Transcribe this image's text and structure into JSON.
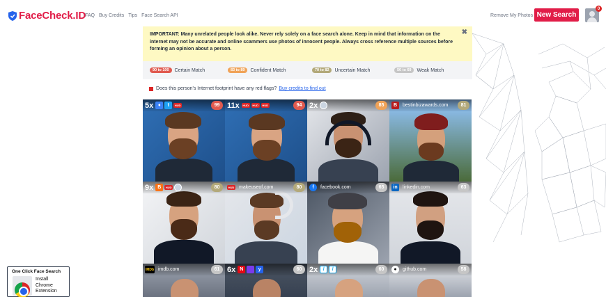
{
  "header": {
    "brand": "FaceCheck.ID",
    "nav": [
      "FAQ",
      "Buy Credits",
      "Tips",
      "Face Search API"
    ],
    "remove_link": "Remove My Photos",
    "new_search": "New Search",
    "notification_count": "0"
  },
  "warning": {
    "text": "IMPORTANT: Many unrelated people look alike. Never rely solely on a face search alone. Keep in mind that information on the internet may not be accurate and online scammers use photos of innocent people. Always cross reference multiple sources before forming an opinion about a person.",
    "close": "✖"
  },
  "legend": [
    {
      "range": "90 to 100",
      "label": "Certain Match",
      "color": "#e05a4f"
    },
    {
      "range": "83 to 89",
      "label": "Confident Match",
      "color": "#f0a358"
    },
    {
      "range": "70 to 82",
      "label": "Uncertain Match",
      "color": "#b3a97a"
    },
    {
      "range": "50 to 69",
      "label": "Weak Match",
      "color": "#c6c6c6"
    }
  ],
  "redflag": {
    "question": "Does this person's Internet footprint have any red flags?",
    "link": "Buy credits to find out"
  },
  "results": [
    {
      "count": "5x",
      "icons": [
        "bluesky",
        "twitter",
        "hud"
      ],
      "score": "99",
      "score_color": "#e05a4f",
      "bar": "top"
    },
    {
      "count": "11x",
      "icons": [
        "hud",
        "hud",
        "hud"
      ],
      "score": "94",
      "score_color": "#e05a4f",
      "bar": "top"
    },
    {
      "count": "2x",
      "icons": [
        "globe"
      ],
      "score": "85",
      "score_color": "#f0a358",
      "bar": "top"
    },
    {
      "source": "bestinbizawards.com",
      "icons": [
        "bestin"
      ],
      "score": "81",
      "score_color": "#b3a97a",
      "bar": "top"
    },
    {
      "count": "9x",
      "icons": [
        "blogger",
        "hud",
        "globe"
      ],
      "score": "80",
      "score_color": "#b3a97a",
      "bar": "bottom"
    },
    {
      "source": "makeuseof.com",
      "icons": [
        "hud"
      ],
      "score": "80",
      "score_color": "#b3a97a",
      "bar": "bottom"
    },
    {
      "source": "facebook.com",
      "icons": [
        "facebook"
      ],
      "score": "65",
      "score_color": "#c6c6c6",
      "bar": "bottom"
    },
    {
      "source": "linkedin.com",
      "icons": [
        "linkedin"
      ],
      "score": "63",
      "score_color": "#c6c6c6",
      "bar": "bottom"
    },
    {
      "source": "imdb.com",
      "icons": [
        "imdb"
      ],
      "score": "61",
      "score_color": "#c6c6c6",
      "bar": "bottom"
    },
    {
      "count": "6x",
      "icons": [
        "netflix",
        "purple",
        "blue-y"
      ],
      "score": "60",
      "score_color": "#c6c6c6",
      "bar": "bottom"
    },
    {
      "count": "2x",
      "icons": [
        "blue-slash",
        "blue-slash"
      ],
      "score": "60",
      "score_color": "#c6c6c6",
      "bar": "bottom"
    },
    {
      "source": "github.com",
      "icons": [
        "github"
      ],
      "score": "58",
      "score_color": "#c6c6c6",
      "bar": "bottom"
    }
  ],
  "extension": {
    "title": "One Click Face Search",
    "label": "Install Chrome Extension"
  }
}
